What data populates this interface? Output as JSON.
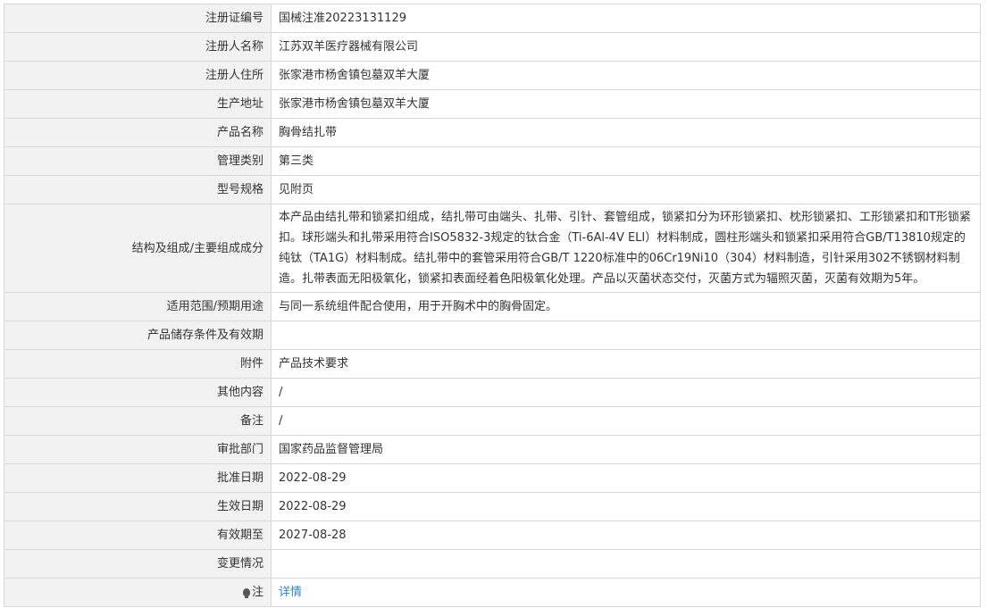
{
  "rows": [
    {
      "label": "注册证编号",
      "value": "国械注准20223131129"
    },
    {
      "label": "注册人名称",
      "value": "江苏双羊医疗器械有限公司"
    },
    {
      "label": "注册人住所",
      "value": "张家港市杨舍镇包墓双羊大厦"
    },
    {
      "label": "生产地址",
      "value": "张家港市杨舍镇包墓双羊大厦"
    },
    {
      "label": "产品名称",
      "value": "胸骨结扎带"
    },
    {
      "label": "管理类别",
      "value": "第三类"
    },
    {
      "label": "型号规格",
      "value": "见附页"
    },
    {
      "label": "结构及组成/主要组成成分",
      "value": "本产品由结扎带和锁紧扣组成，结扎带可由端头、扎带、引针、套管组成，锁紧扣分为环形锁紧扣、枕形锁紧扣、工形锁紧扣和T形锁紧扣。球形端头和扎带采用符合ISO5832-3规定的钛合金（Ti-6Al-4V ELI）材料制成，圆柱形端头和锁紧扣采用符合GB/T13810规定的纯钛（TA1G）材料制成。结扎带中的套管采用符合GB/T 1220标准中的06Cr19Ni10（304）材料制造，引针采用302不锈钢材料制造。扎带表面无阳极氧化，锁紧扣表面经着色阳极氧化处理。产品以灭菌状态交付，灭菌方式为辐照灭菌，灭菌有效期为5年。"
    },
    {
      "label": "适用范围/预期用途",
      "value": "与同一系统组件配合使用，用于开胸术中的胸骨固定。"
    },
    {
      "label": "产品储存条件及有效期",
      "value": ""
    },
    {
      "label": "附件",
      "value": "产品技术要求"
    },
    {
      "label": "其他内容",
      "value": "/"
    },
    {
      "label": "备注",
      "value": "/"
    },
    {
      "label": "审批部门",
      "value": "国家药品监督管理局"
    },
    {
      "label": "批准日期",
      "value": "2022-08-29"
    },
    {
      "label": "生效日期",
      "value": "2022-08-29"
    },
    {
      "label": "有效期至",
      "value": "2027-08-28"
    },
    {
      "label": "变更情况",
      "value": ""
    }
  ],
  "note": {
    "label": "注",
    "link_text": "详情",
    "icon": "lightbulb-icon"
  },
  "colors": {
    "label_bg": "#f2f2f2",
    "border": "#d9d9d9",
    "link": "#2f7fd0",
    "text": "#333333"
  }
}
